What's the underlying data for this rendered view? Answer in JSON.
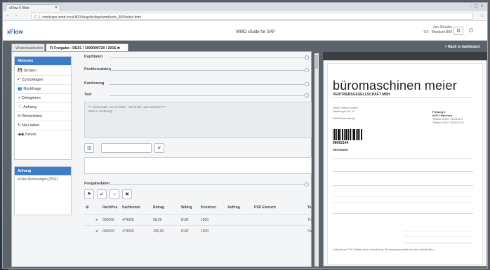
{
  "browser": {
    "tab_title": "xFlow 5 Web",
    "url": "C  ⓘ  wmdsaps.wmd.local:8000/sap/bc/bsp/wmd/ezfs_360/index.html"
  },
  "app": {
    "logo": "xFlow",
    "title": "WMD xSuite for SAP",
    "user_name": "Jan Schulze",
    "user_system": "I10 - Mandant 800",
    "back_label": "< Back to dashboard"
  },
  "tabs": [
    {
      "label": "Weiterbearbeiten"
    },
    {
      "label": "FI Freigabe : DE01 / 1900000729 / 2016 ✖"
    }
  ],
  "sidebar": {
    "header": "Aktionen",
    "items": [
      {
        "label": "Sichern",
        "icon": "save-icon"
      },
      {
        "label": "Zurücklegen",
        "icon": "undo-icon"
      },
      {
        "label": "Rückfrage",
        "icon": "users-icon"
      },
      {
        "label": "Delegieren",
        "icon": "delegate-icon"
      },
      {
        "label": "Anhang",
        "icon": "attachment-icon"
      },
      {
        "label": "Weiterleiten",
        "icon": "forward-icon"
      },
      {
        "label": "Neu laden",
        "icon": "refresh-icon"
      },
      {
        "label": "Zurück",
        "icon": "back-icon"
      }
    ]
  },
  "attachments": {
    "header": "Anhang",
    "items": [
      {
        "label": "xFlow Rechnungen (PDF)"
      }
    ]
  },
  "sections": [
    {
      "label": "Kopfdaten"
    },
    {
      "label": "Positionsdaten"
    },
    {
      "label": "Kontierung"
    },
    {
      "label": "Text"
    }
  ],
  "comment": {
    "line1": "*** SCHULZE, 12.10.2016 - 16:49:58 | Jan Schulze ***",
    "line2": "Alles in Ordnung!"
  },
  "freigabe": {
    "label": "Freigabedaten"
  },
  "table": {
    "headers": [
      "",
      "RechPos",
      "Sachkonto",
      "Betrag",
      "Währg",
      "Kostenst.",
      "Auftrag",
      "PSP Element",
      "Te"
    ],
    "rows": [
      {
        "check": "✔",
        "rechpos": "000002",
        "sachkonto": "474000",
        "betrag": "98,20",
        "waehrung": "EUR",
        "kostenst": "1000",
        "te": "Tri"
      },
      {
        "check": "✔",
        "rechpos": "000003",
        "sachkonto": "474000",
        "betrag": "105,00",
        "waehrung": "EUR",
        "kostenst": "1000",
        "te": "Oe"
      }
    ]
  },
  "document": {
    "brand": "büromaschinen meier",
    "brand_sub": "VERTRIEBSGESELLSCHAFT MBH",
    "recipient": [
      "WMD Vertrieb GmbH",
      "Hamburger Str. 12",
      "22926 Ahrensburg"
    ],
    "sender": [
      "Freiburg 2",
      "81671 München",
      "Telefon 02407 / 524122 0",
      "Telefax 02407 / 524122 10"
    ],
    "barcode_number": "98062144",
    "doc_label": "RECHNUNG",
    "footer_text": "Lieferart: per DHL  Zahlbar sofort ohne Abzug. Skontoabzug besteht mit jeder Lastschriften"
  }
}
